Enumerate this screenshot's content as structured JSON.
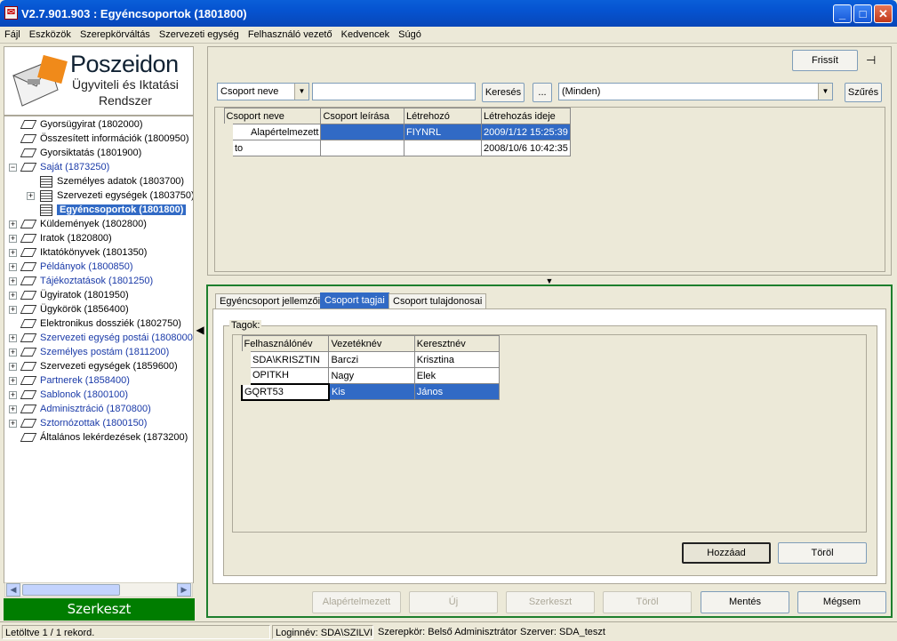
{
  "window": {
    "title": "V2.7.901.903 : Egyéncsoportok (1801800)",
    "app_icon": "app-icon"
  },
  "menu": [
    "Fájl",
    "Eszközök",
    "Szerepkörváltás",
    "Szervezeti egység",
    "Felhasználó vezető",
    "Kedvencek",
    "Súgó"
  ],
  "logo": {
    "line1": "Poszeidon",
    "line2": "Ügyviteli és Iktatási",
    "line3": "Rendszer"
  },
  "tree": [
    {
      "label": "Gyorsügyirat (1802000)"
    },
    {
      "label": "Összesített információk (1800950)"
    },
    {
      "label": "Gyorsiktatás (1801900)"
    },
    {
      "label": "Saját (1873250)"
    },
    {
      "label": "Személyes adatok (1803700)"
    },
    {
      "label": "Szervezeti egységek (1803750)"
    },
    {
      "label": "Egyéncsoportok (1801800)"
    },
    {
      "label": "Küldemények (1802800)"
    },
    {
      "label": "Iratok (1820800)"
    },
    {
      "label": "Iktatókönyvek (1801350)"
    },
    {
      "label": "Példányok (1800850)"
    },
    {
      "label": "Tájékoztatások (1801250)"
    },
    {
      "label": "Ügyiratok (1801950)"
    },
    {
      "label": "Ügykörök (1856400)"
    },
    {
      "label": "Elektronikus dossziék (1802750)"
    },
    {
      "label": "Szervezeti egység postái (1808000)"
    },
    {
      "label": "Személyes postám (1811200)"
    },
    {
      "label": "Szervezeti egységek (1859600)"
    },
    {
      "label": "Partnerek (1858400)"
    },
    {
      "label": "Sablonok (1800100)"
    },
    {
      "label": "Adminisztráció (1870800)"
    },
    {
      "label": "Sztornózottak (1800150)"
    },
    {
      "label": "Általános lekérdezések (1873200)"
    }
  ],
  "edit_button": "Szerkeszt",
  "toolbar": {
    "refresh": "Frissít",
    "pin_icon": "pin-icon"
  },
  "search": {
    "field_select": "Csoport neve",
    "value": "",
    "search_button": "Keresés",
    "more_button": "...",
    "filter_select": "(Minden)",
    "filter_button": "Szűrés"
  },
  "groups_table": {
    "columns": [
      "Csoport neve",
      "Csoport leírása",
      "Létrehozó",
      "Létrehozás ideje"
    ],
    "rows": [
      [
        "Alapértelmezett",
        "",
        "FIYNRL",
        "2009/1/12 15:25:39"
      ],
      [
        "to",
        "",
        "",
        "2008/10/6 10:42:35"
      ]
    ]
  },
  "tabs": [
    "Egyéncsoport jellemzői",
    "Csoport tagjai",
    "Csoport tulajdonosai"
  ],
  "members": {
    "legend": "Tagok:",
    "columns": [
      "Felhasználónév",
      "Vezetéknév",
      "Keresztnév"
    ],
    "rows": [
      [
        "SDA\\KRISZTIN",
        "Barczi",
        "Krisztina"
      ],
      [
        "OPITKH",
        "Nagy",
        "Elek"
      ],
      [
        "GQRT53",
        "Kis",
        "János"
      ]
    ],
    "add_button": "Hozzáad",
    "remove_button": "Töröl"
  },
  "actions": {
    "default": "Alapértelmezett",
    "new": "Új",
    "edit": "Szerkeszt",
    "delete": "Töröl",
    "save": "Mentés",
    "cancel": "Mégsem"
  },
  "status": {
    "records": "Letöltve 1 / 1 rekord.",
    "login": "Loginnév: SDA\\SZILVI",
    "role": "Szerepkör: Belső Adminisztrátor",
    "server": "Szerver: SDA_teszt"
  }
}
